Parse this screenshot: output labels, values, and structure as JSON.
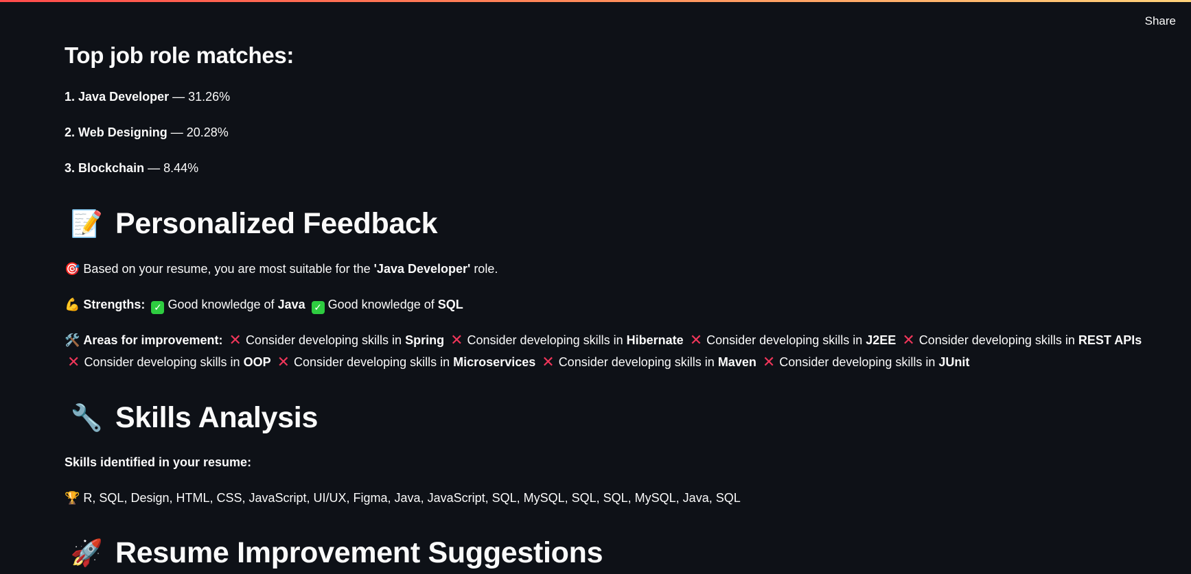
{
  "header": {
    "share_label": "Share"
  },
  "matches": {
    "title": "Top job role matches:",
    "items": [
      {
        "rank": "1.",
        "role": "Java Developer",
        "score": "— 31.26%"
      },
      {
        "rank": "2.",
        "role": "Web Designing",
        "score": "— 20.28%"
      },
      {
        "rank": "3.",
        "role": "Blockchain",
        "score": "— 8.44%"
      }
    ]
  },
  "feedback": {
    "emoji": "📝",
    "title": "Personalized Feedback",
    "suitable": {
      "icon": "🎯",
      "prefix": "Based on your resume, you are most suitable for the ",
      "role": "'Java Developer'",
      "suffix": " role."
    },
    "strengths": {
      "icon": "💪",
      "label": "Strengths:",
      "items": [
        {
          "text": "Good knowledge of ",
          "skill": "Java"
        },
        {
          "text": "Good knowledge of ",
          "skill": "SQL"
        }
      ]
    },
    "improvements": {
      "icon": "🛠️",
      "label": "Areas for improvement:",
      "items": [
        {
          "text": "Consider developing skills in ",
          "skill": "Spring"
        },
        {
          "text": "Consider developing skills in ",
          "skill": "Hibernate"
        },
        {
          "text": "Consider developing skills in ",
          "skill": "J2EE"
        },
        {
          "text": "Consider developing skills in ",
          "skill": "REST APIs"
        },
        {
          "text": "Consider developing skills in ",
          "skill": "OOP"
        },
        {
          "text": "Consider developing skills in ",
          "skill": "Microservices"
        },
        {
          "text": "Consider developing skills in ",
          "skill": "Maven"
        },
        {
          "text": "Consider developing skills in ",
          "skill": "JUnit"
        }
      ]
    }
  },
  "skills": {
    "emoji": "🔧",
    "title": "Skills Analysis",
    "identified_label": "Skills identified in your resume:",
    "list_icon": "🏆",
    "list": "R, SQL, Design, HTML, CSS, JavaScript, UI/UX, Figma, Java, JavaScript, SQL, MySQL, SQL, SQL, MySQL, Java, SQL"
  },
  "suggestions": {
    "emoji": "🚀",
    "title": "Resume Improvement Suggestions"
  },
  "icons": {
    "check": "check-mark-icon",
    "cross": "cross-mark-icon"
  },
  "colors": {
    "background": "#0e1117",
    "text": "#fafafa",
    "check": "#2ecc40",
    "cross": "#f0365a"
  }
}
